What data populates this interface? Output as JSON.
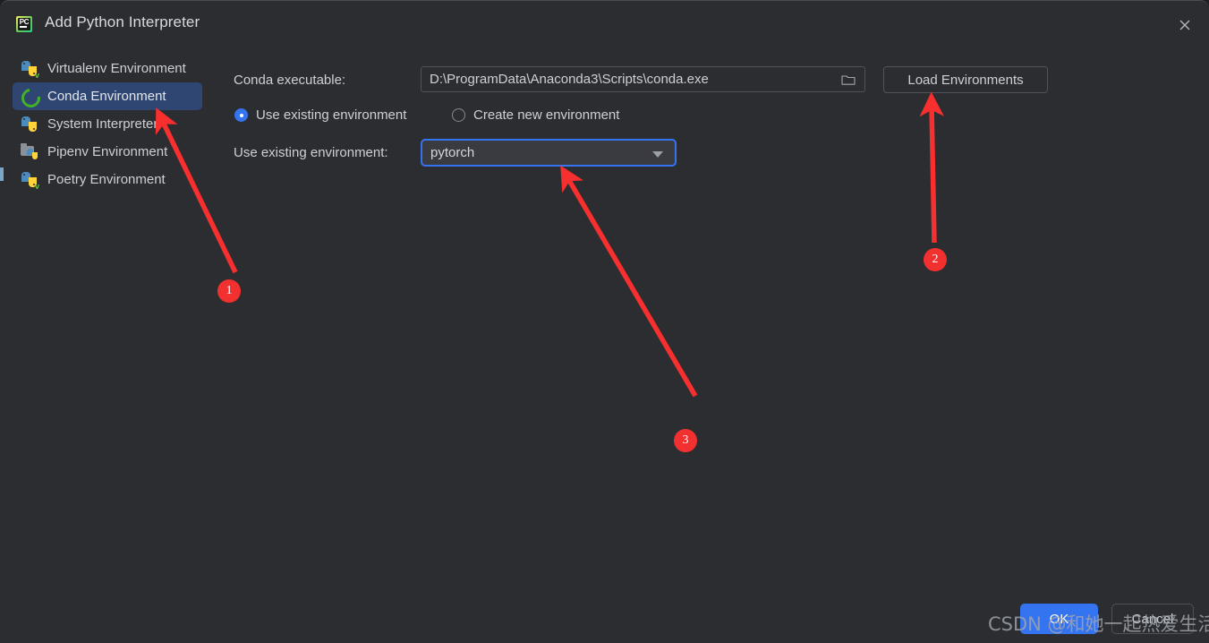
{
  "window": {
    "title": "Add Python Interpreter",
    "app_icon": "pycharm-icon",
    "icon_text": "PC",
    "close_icon": "close-icon"
  },
  "sidebar": {
    "items": [
      {
        "label": "Virtualenv Environment",
        "icon": "python-venv-icon",
        "selected": false
      },
      {
        "label": "Conda Environment",
        "icon": "conda-ring-icon",
        "selected": true
      },
      {
        "label": "System Interpreter",
        "icon": "python-icon",
        "selected": false
      },
      {
        "label": "Pipenv Environment",
        "icon": "pipenv-folder-icon",
        "selected": false
      },
      {
        "label": "Poetry Environment",
        "icon": "python-venv-icon",
        "selected": false
      }
    ]
  },
  "form": {
    "conda_executable_label": "Conda executable:",
    "conda_executable_value": "D:\\ProgramData\\Anaconda3\\Scripts\\conda.exe",
    "browse_icon": "folder-icon",
    "load_environments_label": "Load Environments",
    "radio_use_existing_label": "Use existing environment",
    "radio_create_new_label": "Create new environment",
    "radio_selected": "Use existing environment",
    "use_existing_environment_label": "Use existing environment:",
    "environment_value": "pytorch",
    "combo_arrow_icon": "chevron-down-icon"
  },
  "footer": {
    "ok_label": "OK",
    "cancel_label": "Cancel"
  },
  "annotations": {
    "badges": [
      {
        "number": "1"
      },
      {
        "number": "2"
      },
      {
        "number": "3"
      }
    ]
  },
  "watermark": {
    "text": "CSDN @和她一起热爱生活"
  },
  "colors": {
    "dialog_background": "#2b2d30",
    "selection": "#2f4673",
    "accent": "#3574f0",
    "annotation_red": "#f23030",
    "text": "#ced0d6"
  }
}
